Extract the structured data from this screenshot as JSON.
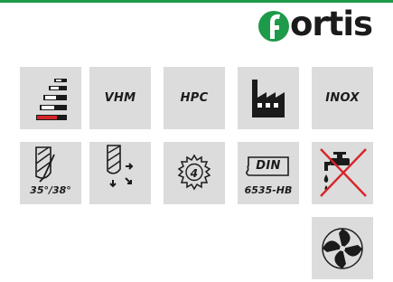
{
  "colors": {
    "brand": "#1d9a4a",
    "tile": "#dcdcdc",
    "accent_red": "#d6242a",
    "ink": "#1b1b1b"
  },
  "logo": {
    "text": "ortis",
    "icon": "fortis-f-mark-icon"
  },
  "tiles": [
    {
      "name": "flute-length-series",
      "icon": "stacked-cutter-lengths-icon"
    },
    {
      "name": "material-vhm",
      "label": "VHM"
    },
    {
      "name": "coating-hpc",
      "label": "HPC"
    },
    {
      "name": "industrial-use",
      "icon": "factory-icon"
    },
    {
      "name": "material-inox",
      "label": "INOX"
    },
    {
      "name": "helix-angle",
      "icon": "helix-angle-icon",
      "label": "35°/38°"
    },
    {
      "name": "cutting-directions",
      "icon": "cutting-direction-arrows-icon"
    },
    {
      "name": "flute-count",
      "icon": "gear-four-flutes-icon",
      "label": "4"
    },
    {
      "name": "din-standard",
      "icon": "din-shank-icon",
      "label": "DIN",
      "sublabel": "6535-HB"
    },
    {
      "name": "no-coolant",
      "icon": "no-coolant-tap-crossed-icon"
    },
    {
      "name": "end-face",
      "icon": "end-mill-face-icon"
    }
  ]
}
